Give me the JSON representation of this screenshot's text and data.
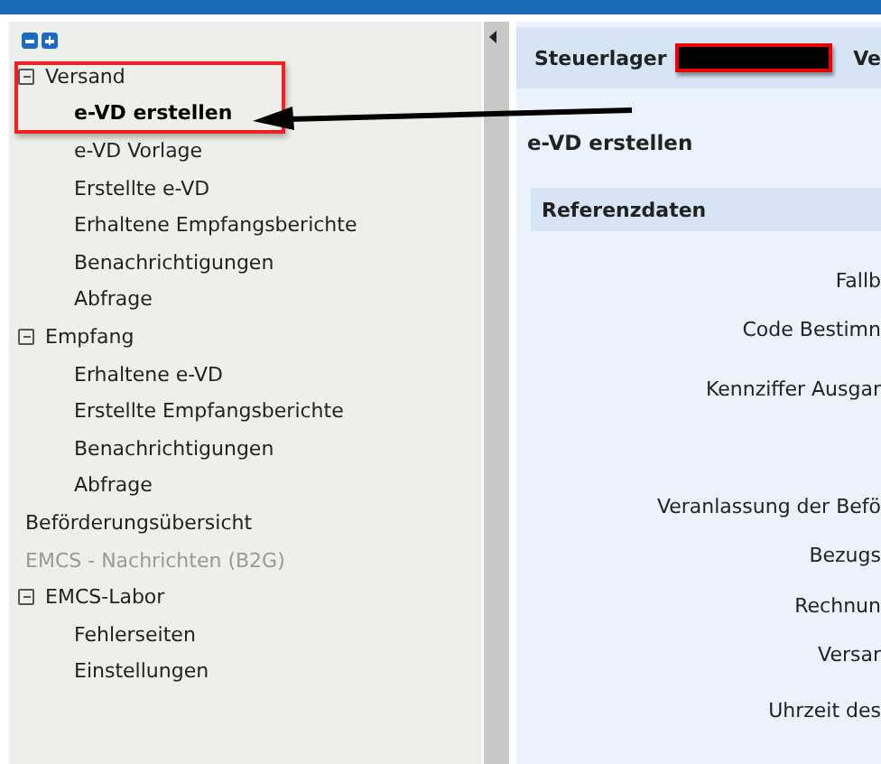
{
  "tree": [
    {
      "label": "Versand",
      "expanded": true,
      "children": [
        {
          "label": "e-VD erstellen",
          "selected": true,
          "disabled": false
        },
        {
          "label": "e-VD Vorlage",
          "selected": false,
          "disabled": false
        },
        {
          "label": "Erstellte e-VD",
          "selected": false,
          "disabled": false
        },
        {
          "label": "Erhaltene Empfangsberichte",
          "selected": false,
          "disabled": false
        },
        {
          "label": "Benachrichtigungen",
          "selected": false,
          "disabled": false
        },
        {
          "label": "Abfrage",
          "selected": false,
          "disabled": false
        }
      ]
    },
    {
      "label": "Empfang",
      "expanded": true,
      "children": [
        {
          "label": "Erhaltene e-VD",
          "selected": false,
          "disabled": false
        },
        {
          "label": "Erstellte Empfangsberichte",
          "selected": false,
          "disabled": false
        },
        {
          "label": "Benachrichtigungen",
          "selected": false,
          "disabled": false
        },
        {
          "label": "Abfrage",
          "selected": false,
          "disabled": false
        }
      ]
    },
    {
      "label": "Beförderungsübersicht",
      "selected": false,
      "disabled": false
    },
    {
      "label": "EMCS - Nachrichten (B2G)",
      "selected": false,
      "disabled": true
    },
    {
      "label": "EMCS-Labor",
      "expanded": true,
      "children": [
        {
          "label": "Fehlerseiten",
          "selected": false,
          "disabled": false
        },
        {
          "label": "Einstellungen",
          "selected": false,
          "disabled": false
        }
      ]
    }
  ],
  "header": {
    "label": "Steuerlager",
    "next_label": "Ve"
  },
  "page_title": "e-VD erstellen",
  "section": {
    "title": "Referenzdaten",
    "fields": [
      "Fallb",
      "Code Bestimn",
      "Kennziffer Ausgar",
      "Veranlassung der Befö",
      "Bezugs",
      "Rechnun",
      "Versar",
      "Uhrzeit des"
    ]
  }
}
